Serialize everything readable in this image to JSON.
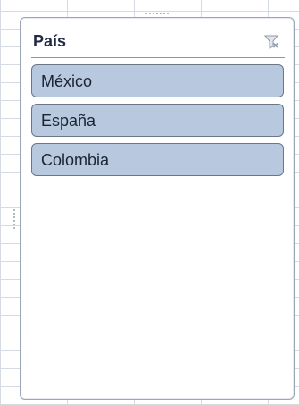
{
  "slicer": {
    "title": "País",
    "clear_filter_icon": "filter-clear-icon",
    "items": [
      {
        "label": "México",
        "selected": true
      },
      {
        "label": "España",
        "selected": true
      },
      {
        "label": "Colombia",
        "selected": true
      }
    ]
  },
  "colors": {
    "item_fill": "#b7c8df",
    "item_border": "#6b7686",
    "header_rule": "#7d97c2",
    "slicer_border": "#9aa6b6"
  }
}
